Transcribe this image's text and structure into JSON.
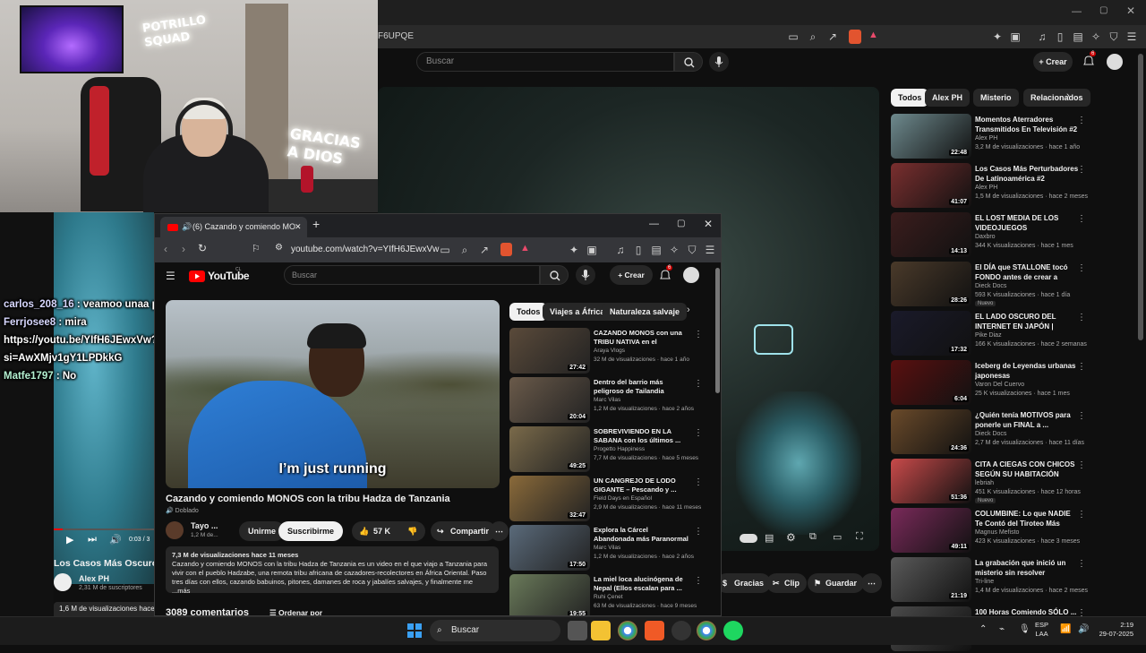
{
  "bg_browser": {
    "url_fragment": "F6UPQE",
    "search_placeholder": "Buscar",
    "crear_label": "Crear",
    "notif_count": "6",
    "chips": [
      "Todos",
      "Alex PH",
      "Misterio",
      "Relacionados"
    ],
    "actions": [
      "Gracias",
      "Clip",
      "Guardar"
    ],
    "recs": [
      {
        "title": "Momentos Aterradores Transmitidos En Televisión #2",
        "channel": "Alex PH",
        "meta": "3,2 M de visualizaciones · hace 1 año",
        "duration": "22:48"
      },
      {
        "title": "Los Casos Más Perturbadores De Latinoamérica #2",
        "channel": "Alex PH",
        "meta": "1,5 M de visualizaciones · hace 2 meses",
        "duration": "41:07"
      },
      {
        "title": "EL LOST MEDIA DE LOS VIDEOJUEGOS",
        "channel": "Daxbro",
        "meta": "344 K visualizaciones · hace 1 mes",
        "duration": "14:13"
      },
      {
        "title": "El DÍA que STALLONE tocó FONDO antes de crear a ROCKY",
        "channel": "Dieck Docs",
        "meta": "593 K visualizaciones · hace 1 día",
        "duration": "28:26",
        "badge": "Nuevo"
      },
      {
        "title": "EL LADO OSCURO DEL INTERNET EN JAPÓN | PARTE 2",
        "channel": "Pike Diaz",
        "meta": "166 K visualizaciones · hace 2 semanas",
        "duration": "17:32"
      },
      {
        "title": "Iceberg de Leyendas urbanas japonesas",
        "channel": "Varon Del Cuervo",
        "meta": "25 K visualizaciones · hace 1 mes",
        "duration": "6:04"
      },
      {
        "title": "¿Quién tenía MOTIVOS para ponerle un FINAL a ...",
        "channel": "Dieck Docs",
        "meta": "2,7 M de visualizaciones · hace 11 días",
        "duration": "24:36"
      },
      {
        "title": "CITA A CIEGAS CON CHICOS SEGÚN SU HABITACIÓN",
        "channel": "lebriah",
        "meta": "451 K visualizaciones · hace 12 horas",
        "duration": "51:36",
        "badge": "Nuevo"
      },
      {
        "title": "COLUMBINE: Lo que NADIE Te Contó del Tiroteo Más Infame ...",
        "channel": "Magnus Mefisto",
        "meta": "423 K visualizaciones · hace 3 meses",
        "duration": "49:11"
      },
      {
        "title": "La grabación que inició un misterio sin resolver",
        "channel": "Tri-line",
        "meta": "1,4 M de visualizaciones · hace 2 meses",
        "duration": "21:19"
      },
      {
        "title": "100 Horas Comiendo SÓLO ...",
        "channel": "",
        "meta": "",
        "duration": ""
      }
    ]
  },
  "webcam": {
    "sign_top": "POTRILLO SQUAD",
    "sign_side": "GRACIAS A DIOS"
  },
  "chat": [
    {
      "user": "carlos_208_16",
      "text": " : veamoo unaa pelicula klaa"
    },
    {
      "user": "Ferrjosee8",
      "text": " : mira"
    },
    {
      "user": "",
      "text": "https://youtu.be/YIfH6JEwxVw?"
    },
    {
      "user": "",
      "text": "si=AwXMjv1gY1LPDkkG"
    },
    {
      "user": "Matfe1797",
      "text": " : No"
    }
  ],
  "left_stream": {
    "time": "0:03 / 3",
    "title": "Los Casos Más Oscuros",
    "channel": "Alex PH",
    "subs": "2,31 M de suscriptores",
    "views": "1,6 M de visualizaciones  hace 3"
  },
  "window": {
    "tab_title": "(6) Cazando y comiendo MO",
    "url": "youtube.com/watch?v=YIfH6JEwxVw",
    "logo": "YouTube",
    "logo_region": "CL",
    "search_placeholder": "Buscar",
    "crear_label": "Crear",
    "subtitle": "I’m just running",
    "video_title": "Cazando y comiendo MONOS con la tribu Hadza de Tanzania",
    "doblado": "Doblado",
    "channel": "Tayo ...",
    "subs": "1,2 M de...",
    "unirse": "Unirme",
    "suscribirse": "Suscribirme",
    "likes": "57 K",
    "compartir": "Compartir",
    "desc_header": "7,3 M de visualizaciones  hace 11 meses",
    "desc_body": "Cazando y comiendo MONOS con la tribu Hadza de Tanzania es un video en el que viajo a Tanzania para vivir con el pueblo Hadzabe, una remota tribu africana de cazadores-recolectores en África Oriental. Paso tres días con ellos, cazando babuinos, pitones, damanes de roca y jabalíes salvajes, y finalmente me ...más",
    "comments": "3089 comentarios",
    "ordenar": "Ordenar por",
    "chips": [
      "Todos",
      "Viajes a África",
      "Naturaleza salvaje"
    ],
    "recs": [
      {
        "title": "CAZANDO MONOS con una TRIBU NATIVA en el CORAZÓ...",
        "channel": "Araya Vlogs",
        "meta": "32 M de visualizaciones · hace 1 año",
        "duration": "27:42"
      },
      {
        "title": "Dentro del barrio más peligroso de Tailandia",
        "channel": "Marc Vilas",
        "meta": "1,2 M de visualizaciones · hace 2 años",
        "duration": "20:04"
      },
      {
        "title": "SOBREVIVIENDO EN LA SABANA con los últimos ...",
        "channel": "Progetto Happiness",
        "meta": "7,7 M de visualizaciones · hace 5 meses",
        "duration": "49:25"
      },
      {
        "title": "UN CANGREJO DE LODO GIGANTE – Pescando y ...",
        "channel": "Field Days en Español",
        "meta": "2,9 M de visualizaciones · hace 11 meses",
        "duration": "32:47"
      },
      {
        "title": "Explora la Cárcel Abandonada más Paranormal de Italia",
        "channel": "Marc Vilas",
        "meta": "1,2 M de visualizaciones · hace 2 años",
        "duration": "17:50"
      },
      {
        "title": "La miel loca alucinógena de Nepal (Ellos escalan para ...",
        "channel": "Ruhi Çenet",
        "meta": "63 M de visualizaciones · hace 9 meses",
        "duration": "19:55"
      }
    ]
  },
  "taskbar": {
    "search": "Buscar",
    "lang1": "ESP",
    "lang2": "LAA",
    "time": "2:19",
    "date": "29-07-2025"
  }
}
